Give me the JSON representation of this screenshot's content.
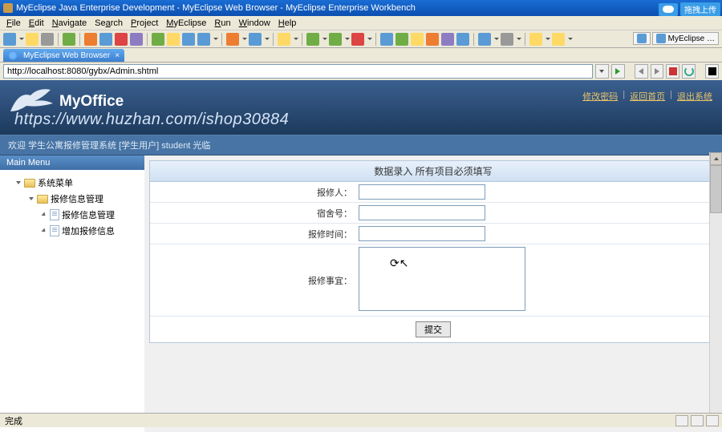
{
  "titlebar": {
    "text": "MyEclipse Java Enterprise Development - MyEclipse Web Browser - MyEclipse Enterprise Workbench"
  },
  "upload": {
    "label": "拖拽上传"
  },
  "menubar": {
    "file": "File",
    "edit": "Edit",
    "navigate": "Navigate",
    "search": "Search",
    "project": "Project",
    "myeclipse": "MyEclipse",
    "run": "Run",
    "window": "Window",
    "help": "Help"
  },
  "perspective": {
    "label": "MyEclipse …"
  },
  "tab": {
    "label": "MyEclipse Web Browser"
  },
  "address": {
    "url": "http://localhost:8080/gybx/Admin.shtml"
  },
  "app": {
    "title": "MyOffice",
    "subtitle": "https://www.huzhan.com/ishop30884",
    "links": {
      "changepw": "修改密码",
      "home": "返回首页",
      "logout": "退出系统"
    },
    "welcome": "欢迎 学生公寓报修管理系统 [学生用户] student 光临"
  },
  "sidebar": {
    "header": "Main Menu",
    "root": "系统菜单",
    "group": "报修信息管理",
    "item1": "报修信息管理",
    "item2": "增加报修信息"
  },
  "form": {
    "title": "数据录入 所有项目必须填写",
    "reporter": "报修人：",
    "room": "宿舍号：",
    "time": "报修时间：",
    "detail": "报修事宜：",
    "submit": "提交"
  },
  "status": {
    "text": "完成"
  }
}
